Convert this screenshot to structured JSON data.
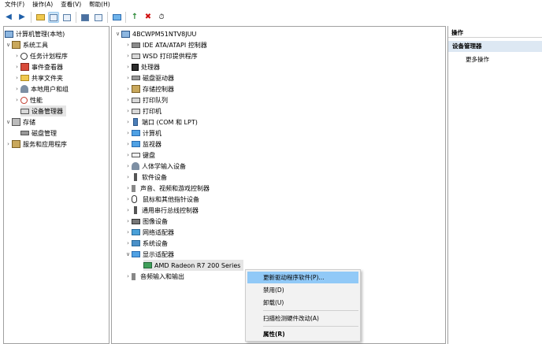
{
  "menubar": {
    "items": [
      "文件(F)",
      "操作(A)",
      "查看(V)",
      "帮助(H)"
    ]
  },
  "left_tree": {
    "root": "计算机管理(本地)",
    "system_tools": "系统工具",
    "task_scheduler": "任务计划程序",
    "event_viewer": "事件查看器",
    "shared_folders": "共享文件夹",
    "local_users": "本地用户和组",
    "performance": "性能",
    "device_manager": "设备管理器",
    "storage": "存储",
    "disk_management": "磁盘管理",
    "services": "服务和应用程序"
  },
  "device_tree": {
    "computer_name": "4BCWPM51NTV8JUU",
    "categories": [
      "IDE ATA/ATAPI 控制器",
      "WSD 打印提供程序",
      "处理器",
      "磁盘驱动器",
      "存储控制器",
      "打印队列",
      "打印机",
      "端口 (COM 和 LPT)",
      "计算机",
      "监视器",
      "键盘",
      "人体学输入设备",
      "软件设备",
      "声音、视频和游戏控制器",
      "鼠标和其他指针设备",
      "通用串行总线控制器",
      "图像设备",
      "网络适配器",
      "系统设备",
      "显示适配器"
    ],
    "display_adapter_child": "AMD Radeon R7 200 Series",
    "last_category": "音频输入和输出"
  },
  "actions_pane": {
    "header": "操作",
    "section": "设备管理器",
    "more": "更多操作"
  },
  "context_menu": {
    "update_driver": "更新驱动程序软件(P)...",
    "disable": "禁用(D)",
    "uninstall": "卸载(U)",
    "scan": "扫描检测硬件改动(A)",
    "properties": "属性(R)"
  },
  "colors": {
    "menu_highlight": "#91c9f7",
    "selection_gray": "#e5e5e5",
    "actions_selected": "#dde8f3"
  }
}
